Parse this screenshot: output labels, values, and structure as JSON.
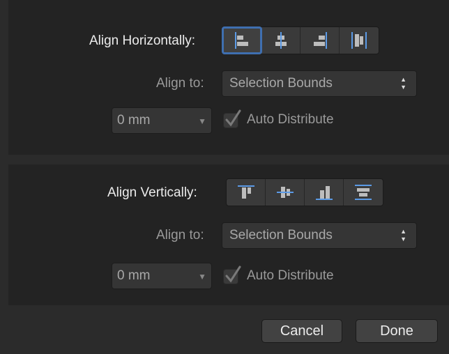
{
  "horizontal": {
    "label": "Align Horizontally:",
    "buttons": [
      {
        "name": "align-left-icon",
        "selected": true
      },
      {
        "name": "align-center-horizontal-icon",
        "selected": false
      },
      {
        "name": "align-right-icon",
        "selected": false
      },
      {
        "name": "distribute-horizontal-icon",
        "selected": false
      }
    ],
    "align_to_label": "Align to:",
    "align_to_value": "Selection Bounds",
    "spacing_value": "0 mm",
    "auto_distribute_label": "Auto Distribute",
    "auto_distribute_checked": true
  },
  "vertical": {
    "label": "Align Vertically:",
    "buttons": [
      {
        "name": "align-top-icon",
        "selected": false
      },
      {
        "name": "align-middle-vertical-icon",
        "selected": false
      },
      {
        "name": "align-bottom-icon",
        "selected": false
      },
      {
        "name": "distribute-vertical-icon",
        "selected": false
      }
    ],
    "align_to_label": "Align to:",
    "align_to_value": "Selection Bounds",
    "spacing_value": "0 mm",
    "auto_distribute_label": "Auto Distribute",
    "auto_distribute_checked": true
  },
  "footer": {
    "cancel_label": "Cancel",
    "done_label": "Done"
  },
  "colors": {
    "accent": "#3f6fb0",
    "guide_blue": "#5b9ae6"
  }
}
